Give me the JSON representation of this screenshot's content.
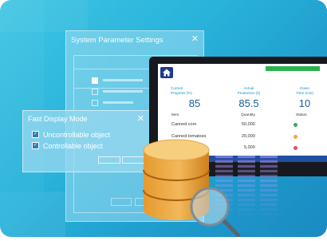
{
  "sys_dialog": {
    "title": "System Parameter Settings",
    "close": "✕",
    "checkbox_states": [
      true,
      false,
      false
    ]
  },
  "fast_dialog": {
    "title": "Fast Display Mode",
    "close": "✕",
    "options": [
      {
        "label": "Uncontrollable object",
        "checked": true
      },
      {
        "label": "Controllable object",
        "checked": true
      }
    ]
  },
  "hmi": {
    "home_icon": "home-icon",
    "stats": [
      {
        "label_line1": "Current",
        "label_line2": "Progress (%)",
        "value": "85"
      },
      {
        "label_line1": "Actual",
        "label_line2": "Production (k)",
        "value": "85.5"
      },
      {
        "label_line1": "Down",
        "label_line2": "Time (min)",
        "value": "10"
      }
    ],
    "table": {
      "columns": [
        "Item",
        "Quantity",
        "Status"
      ],
      "rows": [
        {
          "item": "Canned corn",
          "quantity": "50,000",
          "status_color": "#3aaa5c"
        },
        {
          "item": "Canned tomatoes",
          "quantity": "20,000",
          "status_color": "#f0a93a"
        },
        {
          "item": "",
          "quantity": "5,000",
          "status_color": "#e8485a"
        }
      ]
    },
    "colors": {
      "accent": "#1c8fc9",
      "value": "#1b5e96",
      "green": "#2bb34d",
      "strip": "#1f4fa0"
    }
  },
  "icons": {
    "database": "database-icon",
    "magnifier": "magnifier-icon"
  }
}
